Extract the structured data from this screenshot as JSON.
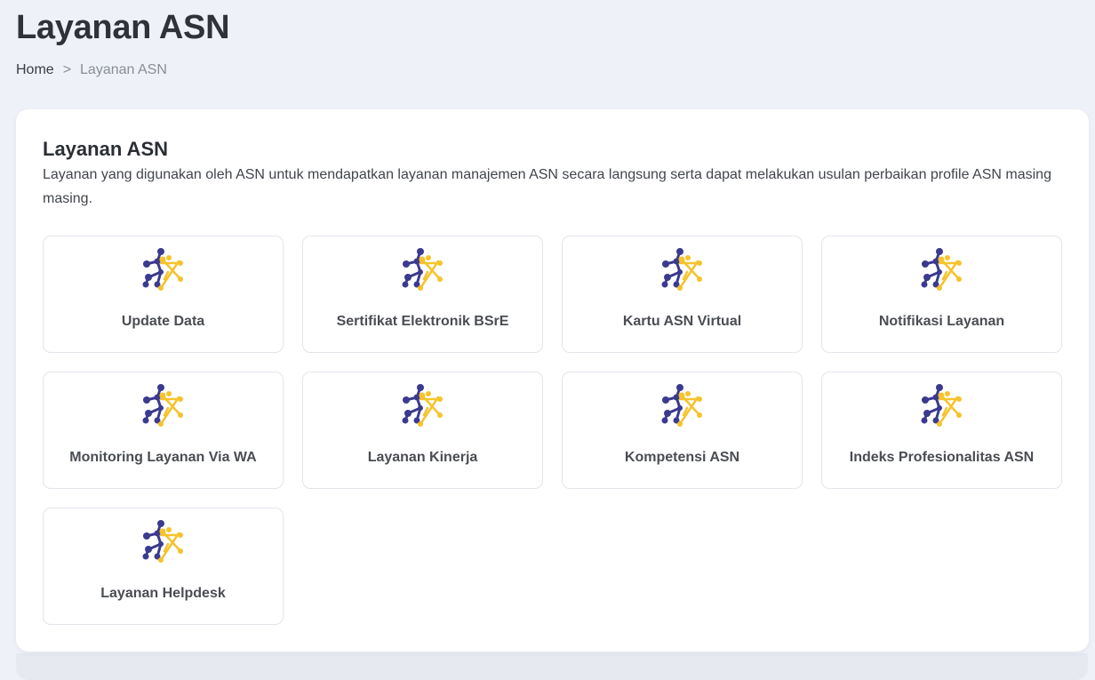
{
  "header": {
    "title": "Layanan ASN"
  },
  "breadcrumb": {
    "home": "Home",
    "separator": ">",
    "current": "Layanan ASN"
  },
  "card": {
    "title": "Layanan ASN",
    "description": "Layanan yang digunakan oleh ASN untuk mendapatkan layanan manajemen ASN secara langsung serta dapat melakukan usulan perbaikan profile ASN masing masing."
  },
  "services": [
    {
      "label": "Update Data",
      "icon": "asn-logo-icon"
    },
    {
      "label": "Sertifikat Elektronik BSrE",
      "icon": "asn-logo-icon"
    },
    {
      "label": "Kartu ASN Virtual",
      "icon": "asn-logo-icon"
    },
    {
      "label": "Notifikasi Layanan",
      "icon": "asn-logo-icon"
    },
    {
      "label": "Monitoring Layanan Via WA",
      "icon": "asn-logo-icon"
    },
    {
      "label": "Layanan Kinerja",
      "icon": "asn-logo-icon"
    },
    {
      "label": "Kompetensi ASN",
      "icon": "asn-logo-icon"
    },
    {
      "label": "Indeks Profesionalitas ASN",
      "icon": "asn-logo-icon"
    },
    {
      "label": "Layanan Helpdesk",
      "icon": "asn-logo-icon"
    }
  ],
  "colors": {
    "logo_navy": "#3b3a8f",
    "logo_yellow": "#f5c32c",
    "page_bg": "#eef1f7",
    "card_bg": "#ffffff"
  }
}
